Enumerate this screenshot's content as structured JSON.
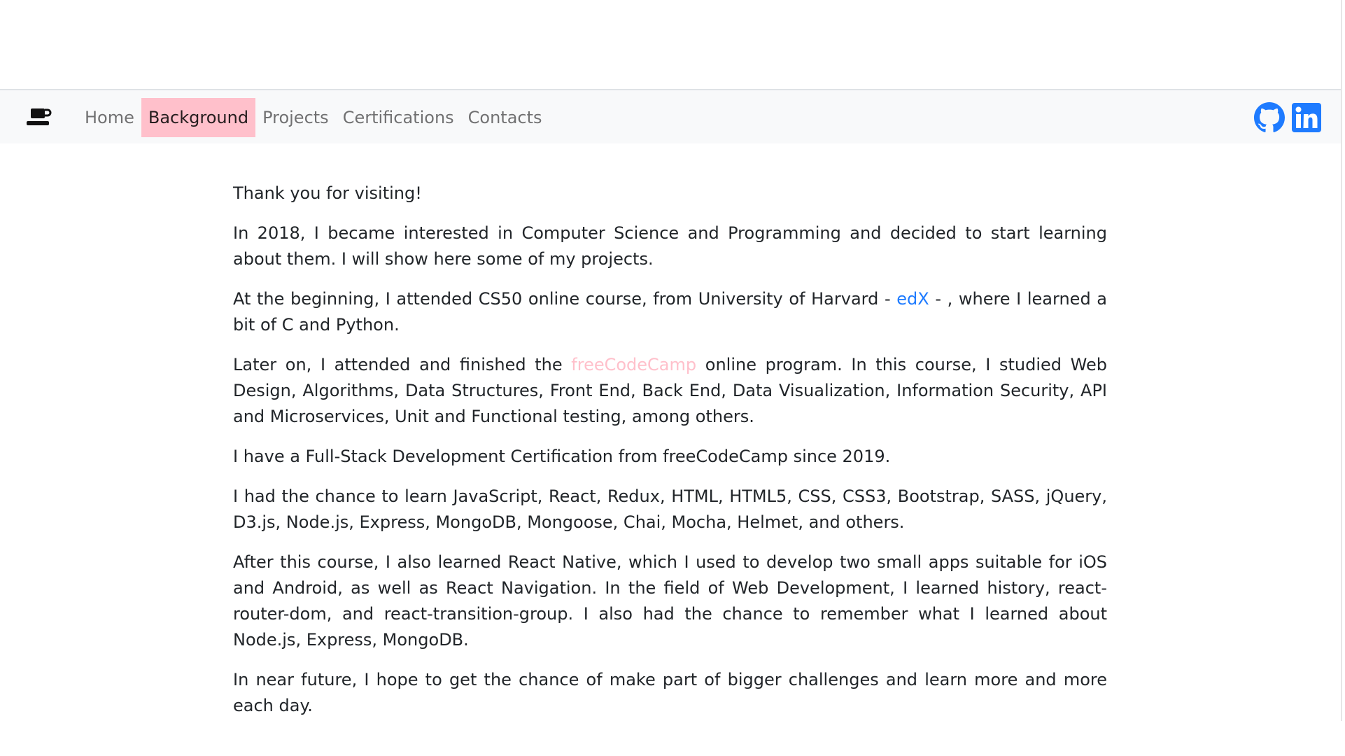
{
  "nav": {
    "brand_icon": "coffee-cup-icon",
    "items": [
      {
        "label": "Home",
        "active": false
      },
      {
        "label": "Background",
        "active": true
      },
      {
        "label": "Projects",
        "active": false
      },
      {
        "label": "Certifications",
        "active": false
      },
      {
        "label": "Contacts",
        "active": false
      }
    ],
    "active_color": "#ffc0cb",
    "social": [
      {
        "icon": "github-icon",
        "color": "#1e7bff"
      },
      {
        "icon": "linkedin-icon",
        "color": "#1e7bff"
      }
    ]
  },
  "content": {
    "p1": "Thank you for visiting!",
    "p2": "In 2018, I became interested in Computer Science and Programming and decided to start learning about them. I will show here some of my projects.",
    "p3": {
      "before": "At the beginning, I attended CS50 online course, from University of Harvard - ",
      "link": "edX",
      "after": " - , where I learned a bit of C and Python."
    },
    "p4": {
      "before": "Later on, I attended and finished the ",
      "link": "freeCodeCamp",
      "after": " online program. In this course, I studied Web Design, Algorithms, Data Structures, Front End, Back End, Data Visualization, Information Security, API and Microservices, Unit and Functional testing, among others."
    },
    "p5": "I have a Full-Stack Development Certification from freeCodeCamp since 2019.",
    "p6": "I had the chance to learn JavaScript, React, Redux, HTML, HTML5, CSS, CSS3, Bootstrap, SASS, jQuery, D3.js, Node.js, Express, MongoDB, Mongoose, Chai, Mocha, Helmet, and others.",
    "p7": "After this course, I also learned React Native, which I used to develop two small apps suitable for iOS and Android, as well as React Navigation. In the field of Web Development, I learned history, react-router-dom, and react-transition-group. I also had the chance to remember what I learned about Node.js, Express, MongoDB.",
    "p8": "In near future, I hope to get the chance of make part of bigger challenges and learn more and more each day."
  },
  "colors": {
    "link_edx": "#1e7bff",
    "link_freecodecamp": "#ffc0cb",
    "navbar_bg": "#f8f9fa"
  }
}
